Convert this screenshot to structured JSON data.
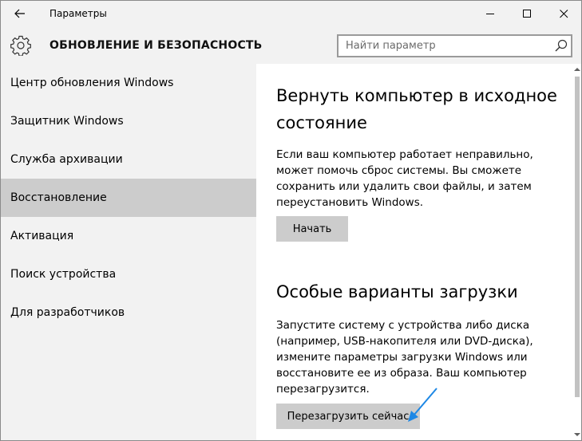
{
  "window": {
    "title": "Параметры",
    "controls": {
      "minimize": "minimize-icon",
      "maximize": "maximize-icon",
      "close": "close-icon"
    }
  },
  "header": {
    "title": "ОБНОВЛЕНИЕ И БЕЗОПАСНОСТЬ",
    "icon": "gear-icon"
  },
  "search": {
    "placeholder": "Найти параметр",
    "value": ""
  },
  "sidebar": {
    "items": [
      {
        "label": "Центр обновления Windows",
        "selected": false
      },
      {
        "label": "Защитник Windows",
        "selected": false
      },
      {
        "label": "Служба архивации",
        "selected": false
      },
      {
        "label": "Восстановление",
        "selected": true
      },
      {
        "label": "Активация",
        "selected": false
      },
      {
        "label": "Поиск устройства",
        "selected": false
      },
      {
        "label": "Для разработчиков",
        "selected": false
      }
    ]
  },
  "main": {
    "reset": {
      "title": "Вернуть компьютер в исходное состояние",
      "description": "Если ваш компьютер работает неправильно, может помочь сброс системы. Вы сможете сохранить или удалить свои файлы, и затем переустановить Windows.",
      "button": "Начать"
    },
    "advanced_startup": {
      "title": "Особые варианты загрузки",
      "description": "Запустите систему с устройства либо диска (например, USB-накопителя или DVD-диска), измените параметры загрузки Windows или восстановите ее из образа. Ваш компьютер перезагрузится.",
      "button": "Перезагрузить сейчас"
    }
  },
  "colors": {
    "chrome_bg": "#f2f2f2",
    "selected_bg": "#cccccc",
    "button_bg": "#cccccc",
    "annotation_arrow": "#1e88e5"
  }
}
